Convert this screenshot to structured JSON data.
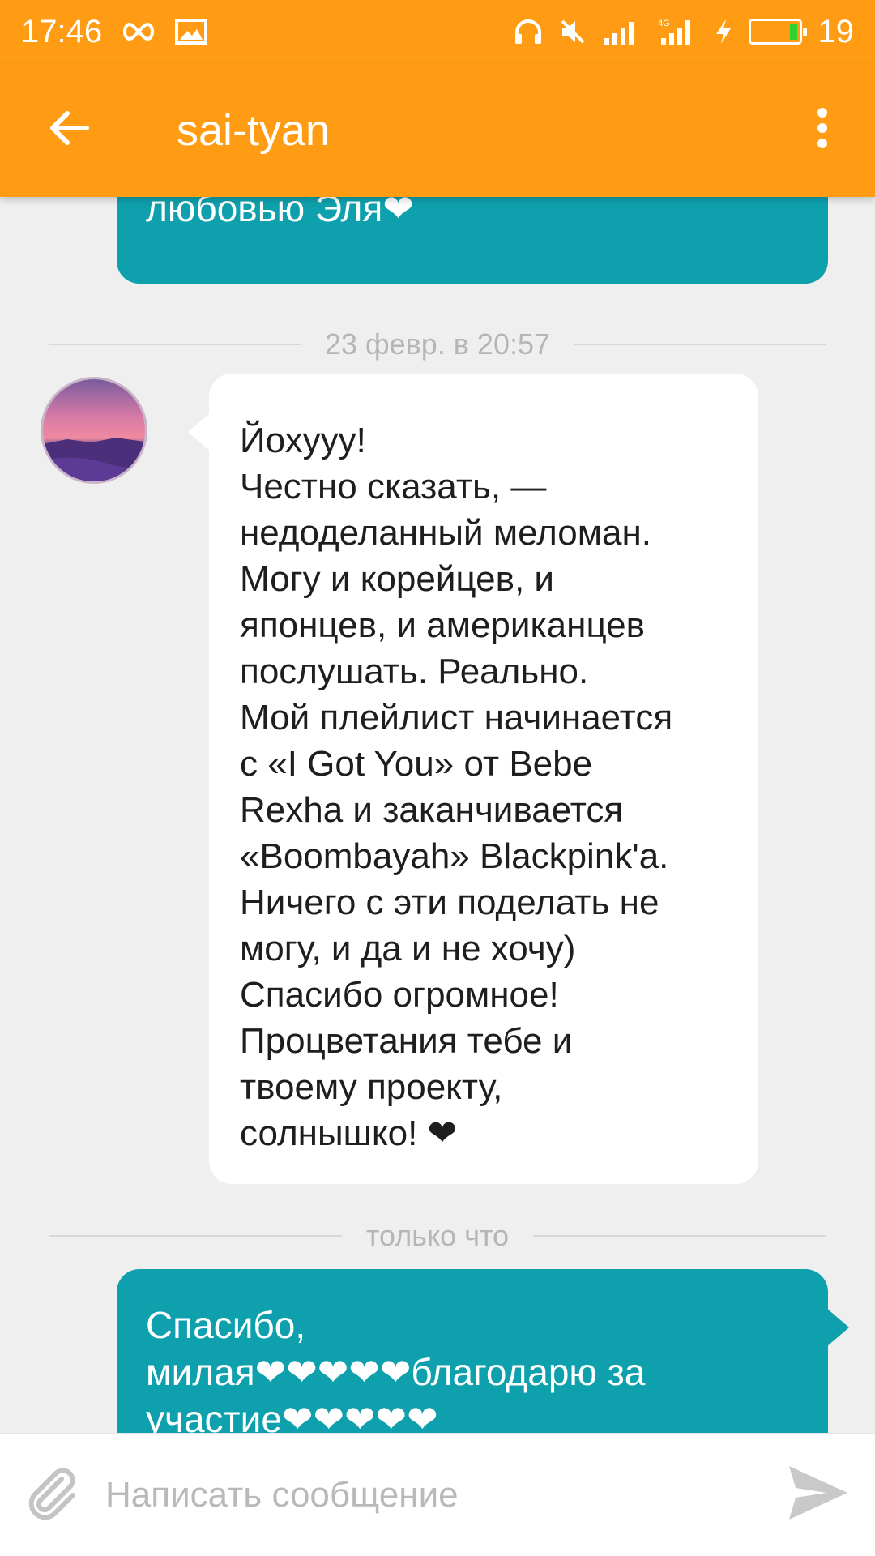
{
  "status_bar": {
    "time": "17:46",
    "battery_level": "19",
    "icons": [
      "infinity-icon",
      "image-icon",
      "headphones-icon",
      "mute-icon",
      "signal-icon",
      "4g-signal-icon",
      "charging-icon",
      "battery-icon"
    ]
  },
  "header": {
    "title": "sai-tyan",
    "back_icon": "arrow-left-icon",
    "menu_icon": "more-vert-icon"
  },
  "colors": {
    "header": "#ff9c13",
    "outgoing_bubble": "#0ea1ad",
    "incoming_bubble": "#ffffff",
    "background": "#efefef"
  },
  "messages": {
    "prev_outgoing": {
      "lines": [
        "любовью Эля❤"
      ]
    },
    "separator_1": "23 февр. в 20:57",
    "incoming": {
      "lines": [
        "Йохууу!",
        "Честно сказать, —",
        "недоделанный меломан.",
        "Могу и корейцев, и",
        "японцев, и американцев",
        "послушать. Реально.",
        "Мой плейлист начинается",
        "с «I Got You» от Bebe",
        "Rexha и заканчивается",
        "«Boombayah» Blackpink'a.",
        "Ничего с эти поделать не",
        "могу, и да и не хочу)",
        "Спасибо огромное!",
        "Процветания тебе и",
        "твоему проекту,",
        "солнышко! ❤"
      ]
    },
    "separator_2": "только что",
    "last_outgoing": {
      "lines": [
        "Спасибо,",
        "милая❤❤❤❤❤благодарю за",
        "участие❤❤❤❤❤"
      ]
    }
  },
  "composer": {
    "placeholder": "Написать сообщение",
    "attach_icon": "paperclip-icon",
    "send_icon": "send-icon"
  }
}
